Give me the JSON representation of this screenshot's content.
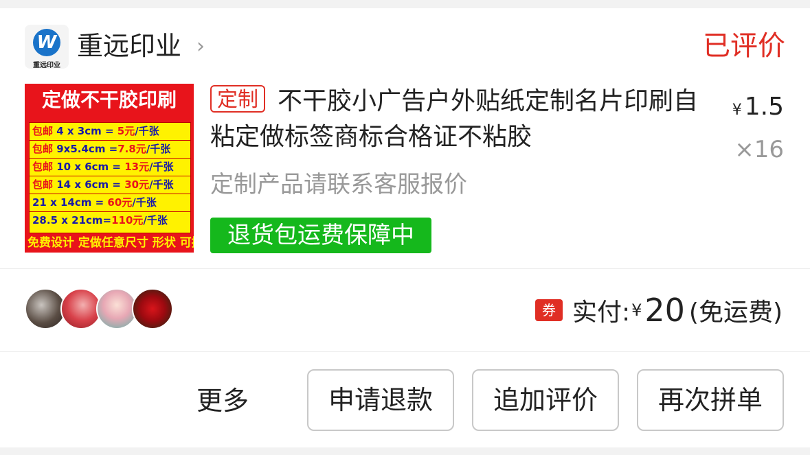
{
  "shop": {
    "name": "重远印业",
    "arrow": "›",
    "logo_mark": "W",
    "logo_text": "重远印业"
  },
  "order": {
    "status": "已评价",
    "status_color": "#e02e24"
  },
  "product": {
    "image": {
      "title": "定做不干胶印刷",
      "rows": [
        {
          "pre": "包邮",
          "size": " 4 x 3cm = ",
          "price": "5元",
          "unit": "/千张"
        },
        {
          "pre": "包邮",
          "size": " 9x5.4cm =",
          "price": "7.8元",
          "unit": "/千张"
        },
        {
          "pre": "包邮",
          "size": " 10 x 6cm = ",
          "price": "13元",
          "unit": "/千张"
        },
        {
          "pre": "包邮",
          "size": " 14 x 6cm = ",
          "price": "30元",
          "unit": "/千张"
        },
        {
          "pre": "",
          "size": "      21 x 14cm = ",
          "price": "60元",
          "unit": "/千张"
        },
        {
          "pre": "",
          "size": " 28.5 x 21cm=",
          "price": "110元",
          "unit": "/千张"
        }
      ],
      "footer": "免费设计 定做任意尺寸 形状 可接急单"
    },
    "tag": "定制",
    "title": "不干胶小广告户外贴纸定制名片印刷自粘定做标签商标合格证不粘胶",
    "price_symbol": "¥",
    "price": "1.5",
    "quantity": "×16",
    "note": "定制产品请联系客服报价",
    "guarantee": "退货包运费保障中",
    "guarantee_color": "#15b81c"
  },
  "payment": {
    "coupon_icon": "券",
    "label": "实付:",
    "symbol": "¥",
    "amount": "20",
    "shipping": "(免运费)"
  },
  "actions": {
    "more": "更多",
    "refund": "申请退款",
    "add_review": "追加评价",
    "reorder": "再次拼单"
  }
}
